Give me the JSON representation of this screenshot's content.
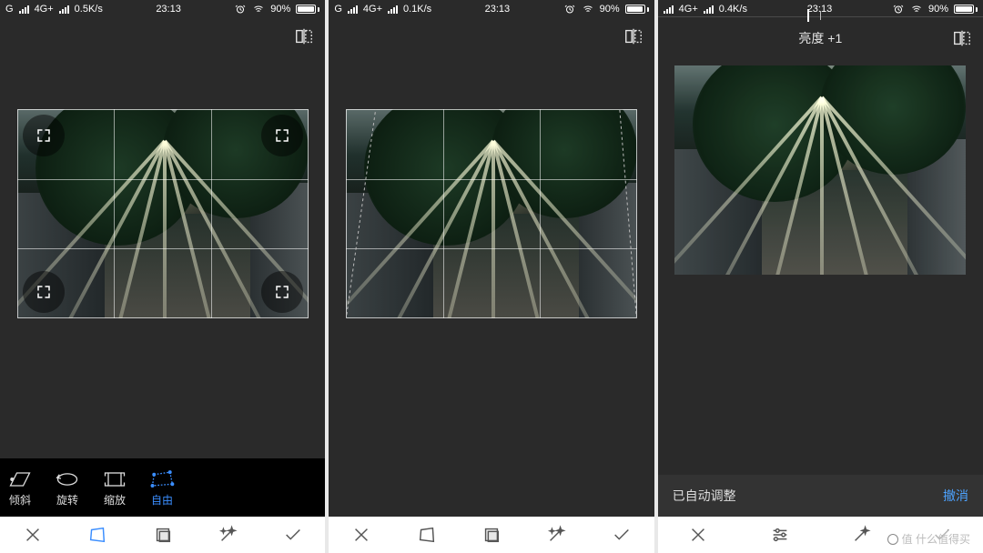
{
  "statusbar": {
    "carrier": "G",
    "net_mode": "4G+",
    "speed_1": "0.5K/s",
    "speed_2": "0.1K/s",
    "speed_3": "0.4K/s",
    "time": "23:13",
    "battery_pct": "90%"
  },
  "panel1": {
    "free_tools": {
      "tilt": "倾斜",
      "rotate": "旋转",
      "scale": "缩放",
      "free": "自由"
    }
  },
  "panel3": {
    "brightness_label": "亮度 +1",
    "auto_msg": "已自动调整",
    "undo": "撤消"
  },
  "icons": {
    "mirror": "mirror-flip-icon",
    "close": "close-icon",
    "crop_persp": "perspective-crop-icon",
    "crop": "crop-icon",
    "wand": "magic-wand-icon",
    "sliders": "adjust-sliders-icon",
    "check": "confirm-check-icon",
    "alarm": "alarm-icon",
    "wifi": "wifi-icon",
    "expand": "expand-handle-icon"
  },
  "watermark": "值  什么值得买"
}
